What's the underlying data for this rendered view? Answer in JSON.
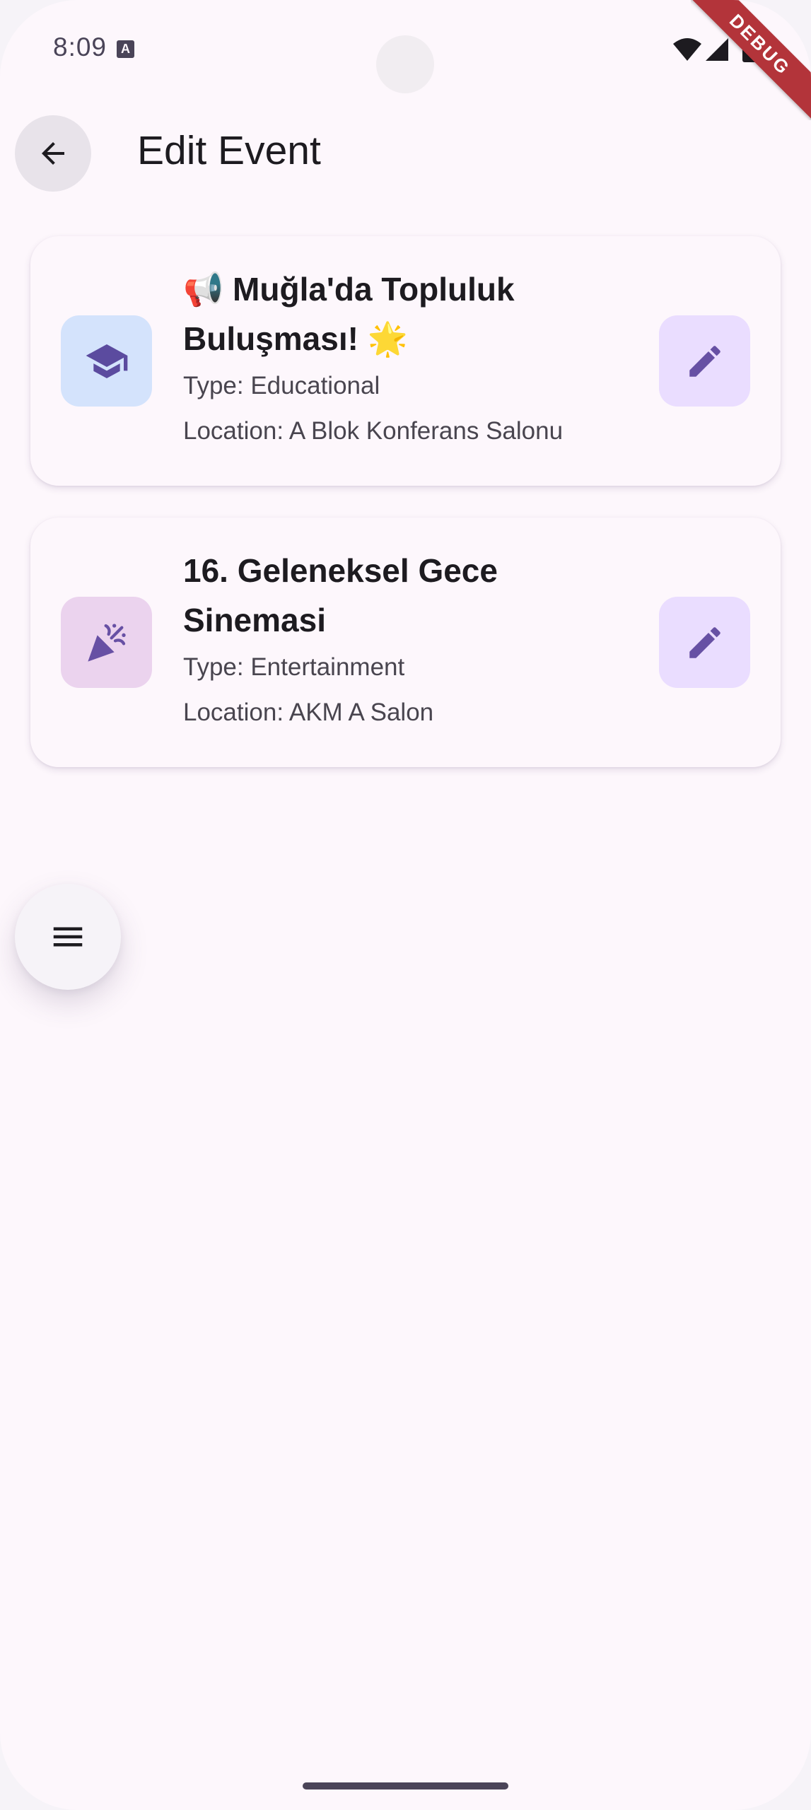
{
  "status_bar": {
    "time": "8:09",
    "notification_icon": "a-icon",
    "debug_label": "DEBUG"
  },
  "app_bar": {
    "back_icon": "arrow-back-icon",
    "title": "Edit Event"
  },
  "events": [
    {
      "title_line1": "📢 Muğla'da Topluluk",
      "title_line2": "Buluşması! 🌟",
      "type": "Type: Educational",
      "location": "Location: A Blok Konferans Salonu",
      "icon": "graduation-cap-icon",
      "tile_color": "#d4e3fc"
    },
    {
      "title_line1": "16. Geleneksel Gece",
      "title_line2": "Sinemasi",
      "type": "Type: Entertainment",
      "location": "Location: AKM A Salon",
      "icon": "party-popper-icon",
      "tile_color": "#ebd3ee"
    }
  ],
  "colors": {
    "background": "#fdf7fc",
    "accent": "#6750a4",
    "edit_tile": "#eaddff"
  },
  "menu_fab": {
    "icon": "menu-icon"
  }
}
